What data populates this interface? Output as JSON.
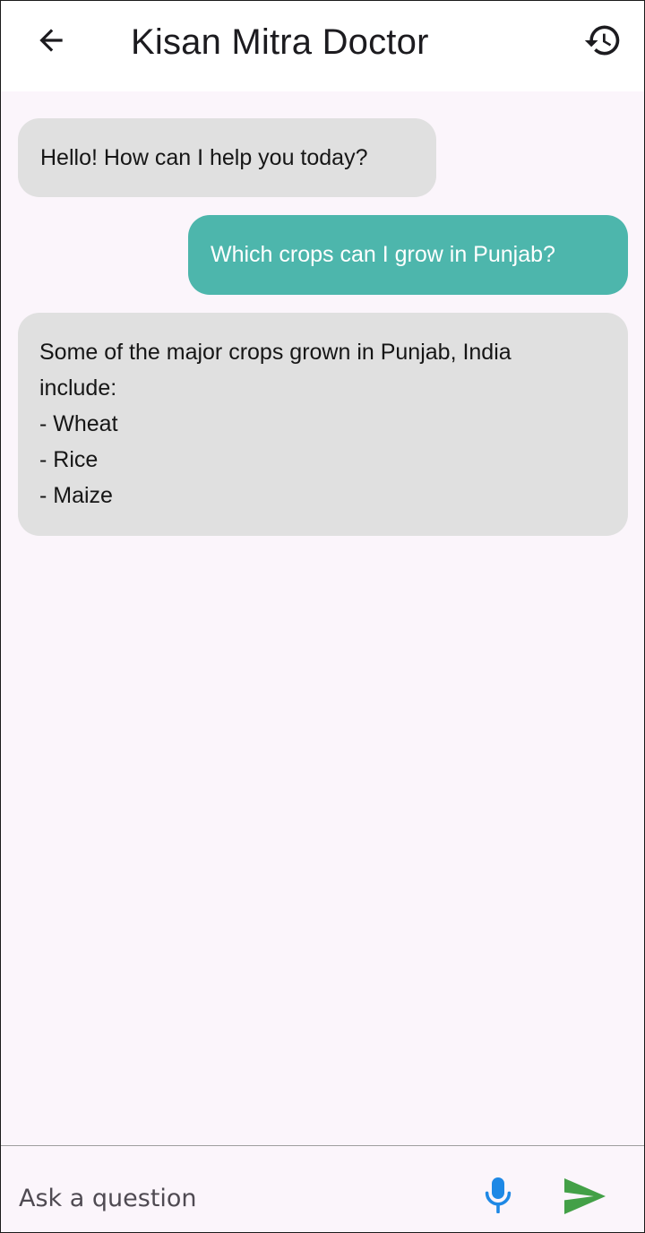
{
  "app_bar": {
    "title": "Kisan Mitra Doctor",
    "back_icon": "arrow-left-icon",
    "history_icon": "history-icon"
  },
  "messages": [
    {
      "sender": "bot",
      "lines": [
        "Hello! How can I help you today?"
      ]
    },
    {
      "sender": "user",
      "lines": [
        "Which crops can I grow in Punjab?"
      ]
    },
    {
      "sender": "bot",
      "lines": [
        "Some of the major crops grown in Punjab, India",
        "include:",
        "- Wheat",
        "- Rice",
        "- Maize"
      ]
    }
  ],
  "input": {
    "placeholder": "Ask a question",
    "value": "",
    "mic_icon": "microphone-icon",
    "send_icon": "send-icon"
  },
  "colors": {
    "background": "#fbf5fb",
    "app_bar": "#ffffff",
    "bot_bubble": "#e0e0e0",
    "user_bubble": "#4db6ac",
    "mic_icon": "#1e88e5",
    "send_icon": "#43a047"
  }
}
